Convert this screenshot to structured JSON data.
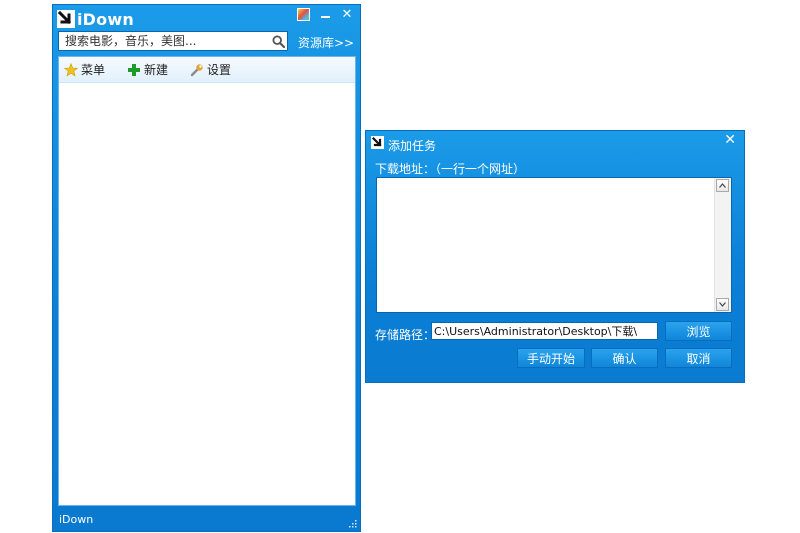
{
  "main_window": {
    "app_name": "iDown",
    "search_placeholder": "搜索电影，音乐，美图...",
    "resource_link": "资源库>>",
    "toolbar": {
      "menu_label": "菜单",
      "new_label": "新建",
      "settings_label": "设置"
    },
    "status_text": "iDown"
  },
  "dialog": {
    "title": "添加任务",
    "url_label": "下载地址：（一行一个网址）",
    "url_value": "",
    "path_label": "存储路径：",
    "path_value": "C:\\Users\\Administrator\\Desktop\\下载\\",
    "browse_label": "浏览",
    "manual_start_label": "手动开始",
    "confirm_label": "确认",
    "cancel_label": "取消"
  },
  "icons": {
    "logo": "arrow-icon",
    "skin": "skin-icon",
    "minimize": "minimize-icon",
    "close": "close-icon",
    "search": "search-icon",
    "menu": "star-icon",
    "new": "plus-icon",
    "settings": "wrench-icon"
  },
  "colors": {
    "window_blue": "#0b7fd6",
    "button_blue": "#1890e2",
    "new_icon_green": "#1e9b2a",
    "menu_icon_yellow": "#f2c21c"
  }
}
